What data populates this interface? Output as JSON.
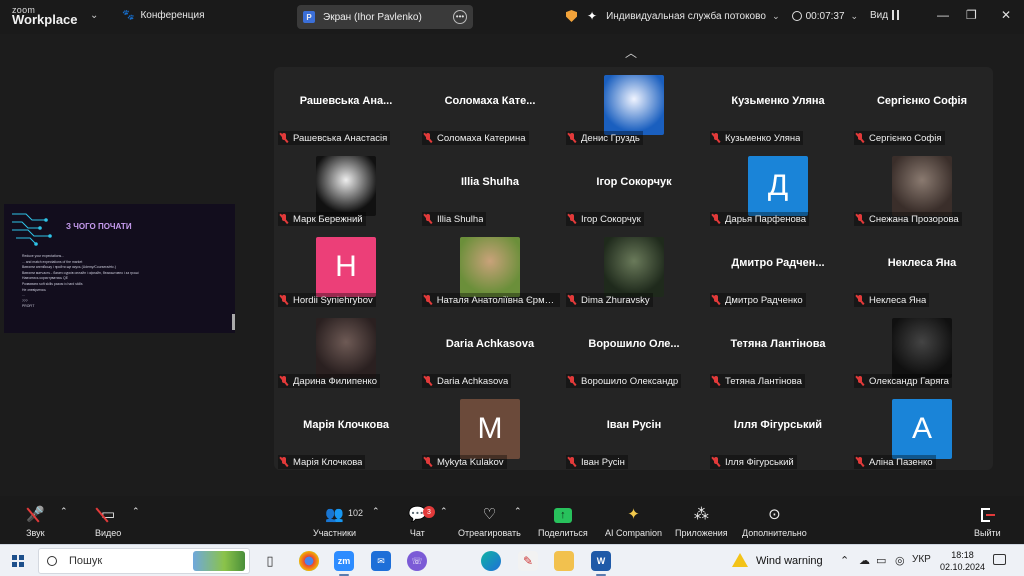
{
  "app": {
    "logo_top": "zoom",
    "logo_bottom": "Workplace",
    "conference_label": "Конференция",
    "screen_share_badge": "P",
    "screen_share_label": "Экран (Ihor Pavlenko)",
    "service_name": "Индивидуальная служба потоково...",
    "timer": "00:07:37",
    "view_label": "Вид",
    "accent": "#0b5cff"
  },
  "shared_screen": {
    "title": "З ЧОГО ПОЧАТИ",
    "bullets": [
      "Reduce your expectations...",
      "... and match expectations of the market",
      "Вивчити англійську і пройти ще якусь (Udemy/Coursera/etc.)",
      "Вивчити матчасть - багато курсів онлайн і офлайн, безкоштовно і за гроші",
      "Навчитись користуватись QE",
      "Розвивати soft skills разом із hard skills",
      "Не зневіритись",
      "...",
      "???",
      "PROFIT"
    ]
  },
  "participants": [
    {
      "label": "Рашевська Анастасія",
      "big": "Рашевська Ана..."
    },
    {
      "label": "Соломаха Катерина",
      "big": "Соломаха Кате..."
    },
    {
      "label": "Денис Груздь",
      "avatar": "photo",
      "photo_colors": [
        "#1a5fbf",
        "#f0f4ff"
      ]
    },
    {
      "label": "Кузьменко Уляна",
      "big": "Кузьменко Уляна"
    },
    {
      "label": "Сергієнко Софія",
      "big": "Сергієнко Софія"
    },
    {
      "label": "Марк Бережний",
      "avatar": "photo",
      "photo_colors": [
        "#111111",
        "#eeeeee"
      ]
    },
    {
      "label": "Illia Shulha",
      "big": "Illia Shulha"
    },
    {
      "label": "Ігор Сокорчук",
      "big": "Ігор Сокорчук"
    },
    {
      "label": "Дарья Парфенова",
      "avatar": "letter",
      "letter": "Д",
      "color": "#1a84d8"
    },
    {
      "label": "Снежана Прозорова",
      "avatar": "photo",
      "photo_colors": [
        "#3a2e2a",
        "#8a7a70"
      ]
    },
    {
      "label": "Hordii Syniehrybov",
      "avatar": "letter",
      "letter": "H",
      "color": "#ec3f78"
    },
    {
      "label": "Наталя Анатоліївна Єрмак...",
      "avatar": "photo",
      "photo_colors": [
        "#6b8f3a",
        "#c9a27a"
      ]
    },
    {
      "label": "Dima Zhuravsky",
      "avatar": "photo",
      "photo_colors": [
        "#1f2a1c",
        "#6a7a5a"
      ]
    },
    {
      "label": "Дмитро Радченко",
      "big": "Дмитро Радчен..."
    },
    {
      "label": "Неклеса Яна",
      "big": "Неклеса Яна"
    },
    {
      "label": "Дарина Филипенко",
      "avatar": "photo",
      "photo_colors": [
        "#2a2020",
        "#6e5a55"
      ]
    },
    {
      "label": "Daria Achkasova",
      "big": "Daria Achkasova"
    },
    {
      "label": "Ворошило Олександр",
      "big": "Ворошило Оле..."
    },
    {
      "label": "Тетяна Лантінова",
      "big": "Тетяна Лантінова"
    },
    {
      "label": "Олександр Гаряга",
      "avatar": "photo",
      "photo_colors": [
        "#101010",
        "#444444"
      ]
    },
    {
      "label": "Марія Клочкова",
      "big": "Марія Клочкова"
    },
    {
      "label": "Mykyta Kulakov",
      "avatar": "letter",
      "letter": "M",
      "color": "#6b4a3a"
    },
    {
      "label": "Іван Русін",
      "big": "Іван Русін"
    },
    {
      "label": "Ілля Фігурський",
      "big": "Ілля Фігурський"
    },
    {
      "label": "Аліна Пазенко",
      "avatar": "letter",
      "letter": "A",
      "color": "#1a84d8"
    }
  ],
  "controls": {
    "audio": "Звук",
    "video": "Видео",
    "participants": "Участники",
    "participants_count": "102",
    "chat": "Чат",
    "chat_badge": "3",
    "react": "Отреагировать",
    "share": "Поделиться",
    "ai": "AI Companion",
    "apps": "Приложения",
    "more": "Дополнительно",
    "leave": "Выйти"
  },
  "taskbar": {
    "search_placeholder": "Пошук",
    "zoom_app": "zm",
    "word_app": "W",
    "weather": "Wind warning",
    "lang": "УКР",
    "time": "18:18",
    "date": "02.10.2024"
  }
}
